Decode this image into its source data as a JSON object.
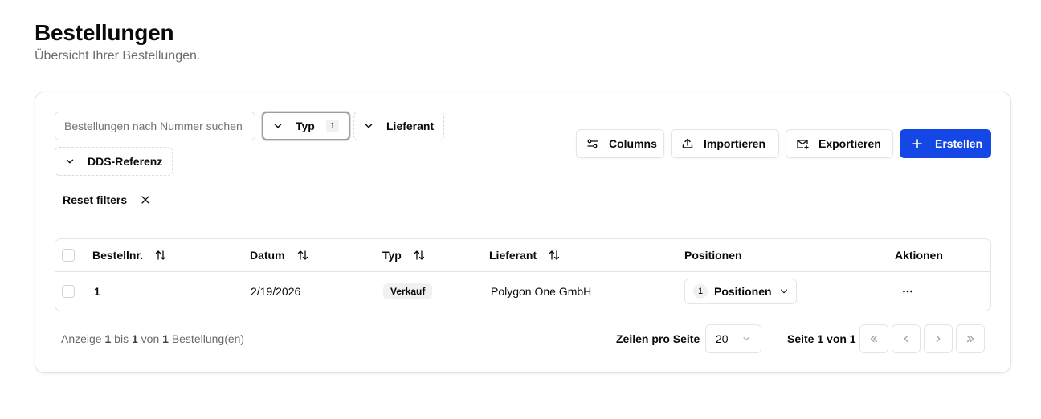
{
  "header": {
    "title": "Bestellungen",
    "subtitle": "Übersicht Ihrer Bestellungen."
  },
  "toolbar": {
    "search_placeholder": "Bestellungen nach Nummer suchen",
    "search_value": "",
    "filters": [
      {
        "label": "Typ",
        "count": "1",
        "icon": "chevron-down-icon"
      },
      {
        "label": "Lieferant",
        "icon": "chevron-down-icon"
      },
      {
        "label": "DDS-Referenz",
        "icon": "chevron-down-icon"
      }
    ],
    "reset_label": "Reset filters",
    "columns_label": "Columns",
    "import_label": "Importieren",
    "export_label": "Exportieren",
    "create_label": "Erstellen"
  },
  "table": {
    "columns": [
      "Bestellnr.",
      "Datum",
      "Typ",
      "Lieferant",
      "Positionen",
      "Aktionen"
    ],
    "rows": [
      {
        "number": "1",
        "date": "2/19/2026",
        "type": "Verkauf",
        "supplier": "Polygon One GmbH",
        "positions_count": "1",
        "positions_label": "Positionen"
      }
    ]
  },
  "pagination": {
    "info_prefix": "Anzeige",
    "info_from": "1",
    "info_mid1": "bis",
    "info_to": "1",
    "info_mid2": "von",
    "info_total": "1",
    "info_suffix": "Bestellung(en)",
    "rows_per_page_label": "Zeilen pro Seite",
    "rows_per_page_value": "20",
    "page_label": "Seite 1 von 1"
  },
  "colors": {
    "accent": "#1547e6",
    "border": "#e4e4e7",
    "muted_text": "#6b6b6b"
  }
}
